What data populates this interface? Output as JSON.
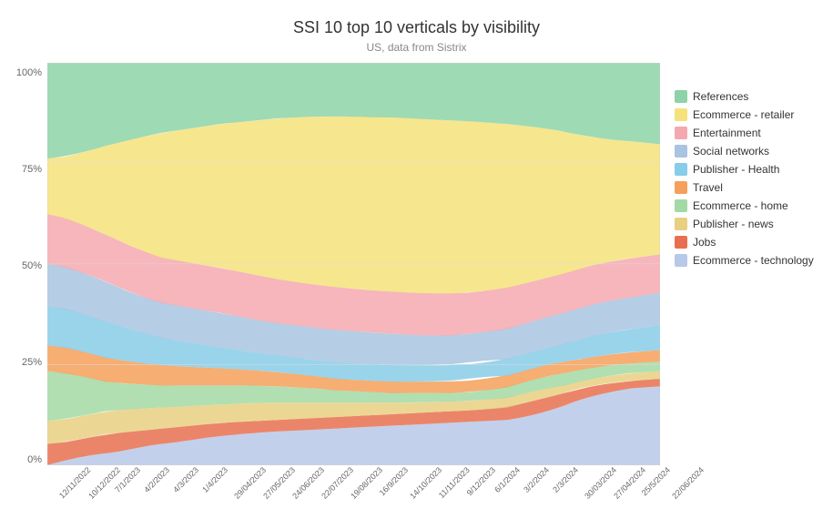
{
  "title": "SSI 10 top 10 verticals by visibility",
  "subtitle": "US, data from Sistrix",
  "yLabels": [
    "100%",
    "75%",
    "50%",
    "25%",
    "0%"
  ],
  "xLabels": [
    "12/11/2022",
    "10/12/2022",
    "7/1/2023",
    "4/2/2023",
    "4/3/2023",
    "1/4/2023",
    "29/04/2023",
    "27/05/2023",
    "24/06/2023",
    "22/07/2023",
    "19/08/2023",
    "16/9/2023",
    "14/10/2023",
    "11/11/2023",
    "9/12/2023",
    "6/1/2024",
    "3/2/2024",
    "2/3/2024",
    "30/03/2024",
    "27/04/2024",
    "25/5/2024",
    "22/06/2024"
  ],
  "legend": [
    {
      "label": "References",
      "color": "#8dd3a7"
    },
    {
      "label": "Ecommerce - retailer",
      "color": "#f5e27a"
    },
    {
      "label": "Entertainment",
      "color": "#f4a9b0"
    },
    {
      "label": "Social networks",
      "color": "#a8c4e0"
    },
    {
      "label": "Publisher - Health",
      "color": "#87cce8"
    },
    {
      "label": "Travel",
      "color": "#f5a05a"
    },
    {
      "label": "Ecommerce - home",
      "color": "#a3d9a5"
    },
    {
      "label": "Publisher - news",
      "color": "#e8d080"
    },
    {
      "label": "Jobs",
      "color": "#e87050"
    },
    {
      "label": "Ecommerce - technology",
      "color": "#b8c8e8"
    }
  ],
  "colors": {
    "references": "#8dd3a7",
    "ecommerce_retailer": "#f5e27a",
    "entertainment": "#f4a9b0",
    "social_networks": "#a8c4e0",
    "publisher_health": "#87cce8",
    "travel": "#f5a05a",
    "ecommerce_home": "#a3d9a5",
    "publisher_news": "#e8d080",
    "jobs": "#e87050",
    "ecommerce_technology": "#b8c8e8"
  }
}
